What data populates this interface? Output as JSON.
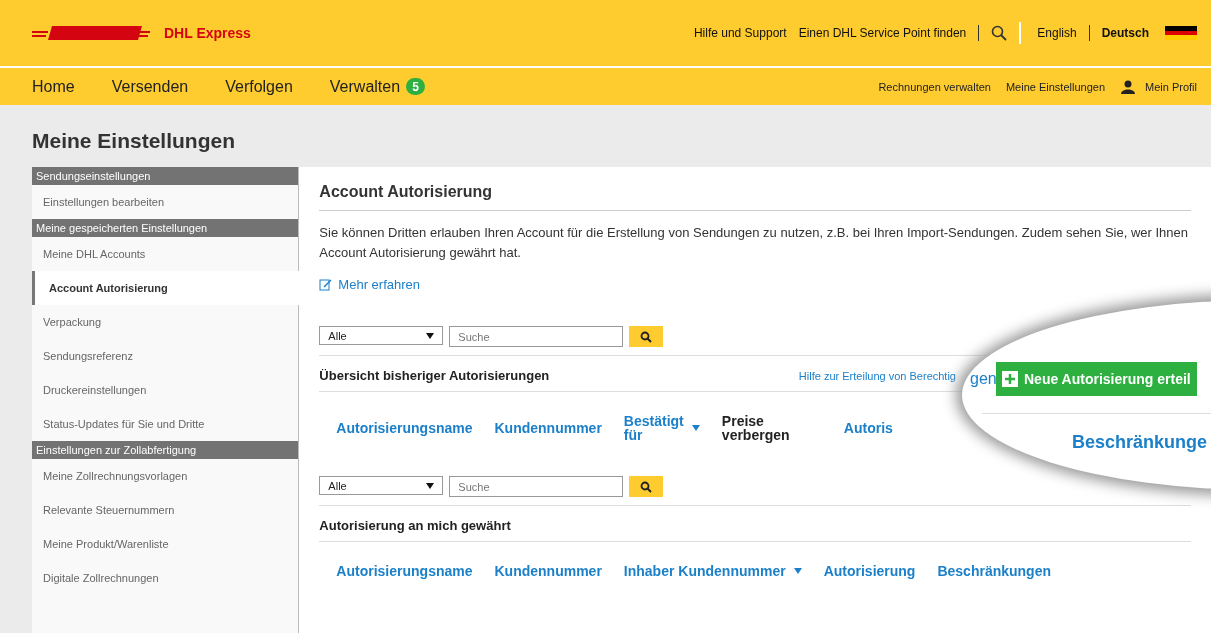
{
  "header": {
    "brand": "DHL Express",
    "links": [
      "Hilfe und Support",
      "Einen DHL Service Point finden"
    ],
    "languages": [
      {
        "label": "English",
        "selected": false
      },
      {
        "label": "Deutsch",
        "selected": true
      }
    ]
  },
  "nav": {
    "items": [
      {
        "label": "Home"
      },
      {
        "label": "Versenden"
      },
      {
        "label": "Verfolgen"
      },
      {
        "label": "Verwalten",
        "badge": "5"
      }
    ],
    "right": [
      "Rechnungen verwalten",
      "Meine Einstellungen",
      "Mein Profil"
    ]
  },
  "page_title": "Meine Einstellungen",
  "sidebar": [
    {
      "kind": "header",
      "label": "Sendungseinstellungen"
    },
    {
      "kind": "item",
      "label": "Einstellungen bearbeiten",
      "selected": false
    },
    {
      "kind": "header",
      "label": "Meine gespeicherten Einstellungen"
    },
    {
      "kind": "item",
      "label": "Meine DHL Accounts",
      "selected": false
    },
    {
      "kind": "item",
      "label": "Account Autorisierung",
      "selected": true
    },
    {
      "kind": "item",
      "label": "Verpackung",
      "selected": false
    },
    {
      "kind": "item",
      "label": "Sendungsreferenz",
      "selected": false
    },
    {
      "kind": "item",
      "label": "Druckereinstellungen",
      "selected": false
    },
    {
      "kind": "item",
      "label": "Status-Updates für Sie und Dritte",
      "selected": false
    },
    {
      "kind": "header",
      "label": "Einstellungen zur Zollabfertigung"
    },
    {
      "kind": "item",
      "label": "Meine Zollrechnungsvorlagen",
      "selected": false
    },
    {
      "kind": "item",
      "label": "Relevante Steuernummern",
      "selected": false
    },
    {
      "kind": "item",
      "label": "Meine Produkt/Warenliste",
      "selected": false
    },
    {
      "kind": "item",
      "label": "Digitale Zollrechnungen",
      "selected": false
    }
  ],
  "main": {
    "title": "Account Autorisierung",
    "intro": "Sie können Dritten erlauben Ihren Account für die Erstellung von Sendungen zu nutzen, z.B. bei Ihren Import-Sendungen. Zudem sehen Sie, wer Ihnen Account Autorisierung gewährt hat.",
    "learn_more": "Mehr erfahren",
    "sections": [
      {
        "filter": {
          "value": "Alle",
          "placeholder": "Suche"
        },
        "title": "Übersicht bisheriger Autorisierungen",
        "help_link": "Hilfe zur Erteilung von Berechtig",
        "columns": [
          {
            "label": "Autorisierungsname",
            "kind": "link"
          },
          {
            "label": "Kundennummer",
            "kind": "link"
          },
          {
            "label": "Bestätigt für",
            "kind": "sort"
          },
          {
            "label": "Preise verbergen",
            "kind": "plain"
          },
          {
            "label": "Autoris",
            "kind": "link"
          }
        ]
      },
      {
        "filter": {
          "value": "Alle",
          "placeholder": "Suche"
        },
        "title": "Autorisierung an mich gewährt",
        "columns": [
          {
            "label": "Autorisierungsname",
            "kind": "link"
          },
          {
            "label": "Kundennummer",
            "kind": "link"
          },
          {
            "label": "Inhaber Kundennummer",
            "kind": "sort"
          },
          {
            "label": "Autorisierung",
            "kind": "link"
          },
          {
            "label": "Beschränkungen",
            "kind": "link"
          }
        ]
      }
    ]
  },
  "magnifier": {
    "help_link_end": "gen",
    "button": "Neue Autorisierung erteil",
    "column": "Beschränkunge"
  }
}
